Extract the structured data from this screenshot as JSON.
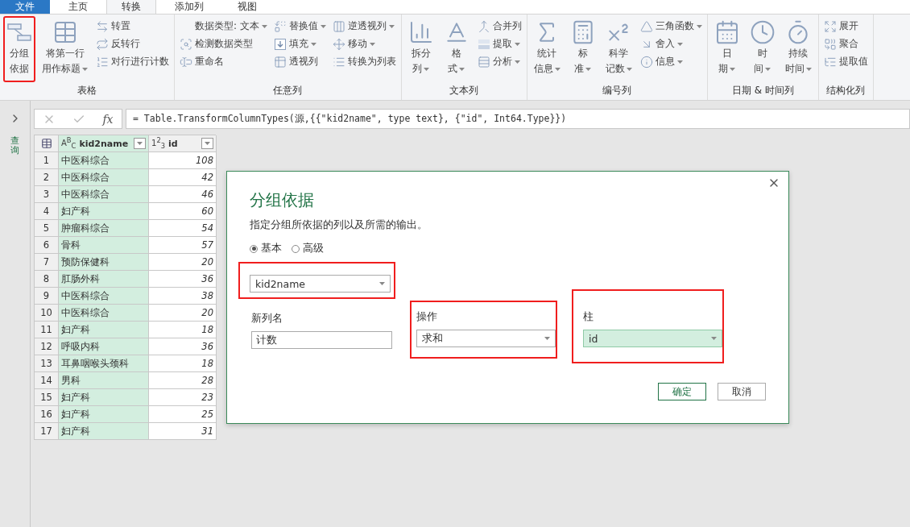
{
  "menu_tabs": [
    {
      "label": "文件",
      "kind": "file",
      "selected": false
    },
    {
      "label": "主页",
      "kind": "tab",
      "selected": false
    },
    {
      "label": "转换",
      "kind": "tab",
      "selected": true
    },
    {
      "label": "添加列",
      "kind": "tab",
      "selected": false
    },
    {
      "label": "视图",
      "kind": "tab",
      "selected": false
    }
  ],
  "ribbon": [
    {
      "label": "表格",
      "items": [
        {
          "kind": "large",
          "lines": [
            "分组",
            "依据"
          ],
          "dropdown": false,
          "highlighted": true
        },
        {
          "kind": "large",
          "lines": [
            "将第一行",
            "用作标题"
          ],
          "dropdown": true,
          "highlighted": false
        },
        {
          "kind": "small",
          "label": "转置",
          "dropdown": false
        },
        {
          "kind": "small",
          "label": "反转行",
          "dropdown": false
        },
        {
          "kind": "small",
          "label": "对行进行计数",
          "dropdown": false
        }
      ]
    },
    {
      "label": "任意列",
      "items": [
        {
          "kind": "small",
          "label": "数据类型: 文本",
          "dropdown": true
        },
        {
          "kind": "small",
          "label": "检测数据类型",
          "dropdown": false
        },
        {
          "kind": "small",
          "label": "重命名",
          "dropdown": false
        },
        {
          "kind": "small",
          "label": "替换值",
          "dropdown": true
        },
        {
          "kind": "small",
          "label": "填充",
          "dropdown": true
        },
        {
          "kind": "small",
          "label": "透视列",
          "dropdown": false
        },
        {
          "kind": "small",
          "label": "逆透视列",
          "dropdown": true
        },
        {
          "kind": "small",
          "label": "移动",
          "dropdown": true
        },
        {
          "kind": "small",
          "label": "转换为列表",
          "dropdown": false
        }
      ]
    },
    {
      "label": "文本列",
      "items": [
        {
          "kind": "large",
          "lines": [
            "拆分",
            "列"
          ],
          "dropdown": true,
          "highlighted": false
        },
        {
          "kind": "large",
          "lines": [
            "格",
            "式"
          ],
          "dropdown": true,
          "highlighted": false
        },
        {
          "kind": "small",
          "label": "合并列",
          "dropdown": false
        },
        {
          "kind": "small",
          "label": "提取",
          "dropdown": true
        },
        {
          "kind": "small",
          "label": "分析",
          "dropdown": true
        }
      ]
    },
    {
      "label": "编号列",
      "items": [
        {
          "kind": "large",
          "lines": [
            "统计",
            "信息"
          ],
          "dropdown": true,
          "highlighted": false
        },
        {
          "kind": "large",
          "lines": [
            "标",
            "准"
          ],
          "dropdown": true,
          "highlighted": false
        },
        {
          "kind": "large",
          "lines": [
            "科学",
            "记数"
          ],
          "dropdown": true,
          "highlighted": false
        },
        {
          "kind": "small",
          "label": "三角函数",
          "dropdown": true
        },
        {
          "kind": "small",
          "label": "舍入",
          "dropdown": true
        },
        {
          "kind": "small",
          "label": "信息",
          "dropdown": true
        }
      ]
    },
    {
      "label": "日期 & 时间列",
      "items": [
        {
          "kind": "large",
          "lines": [
            "日",
            "期"
          ],
          "dropdown": true,
          "highlighted": false
        },
        {
          "kind": "large",
          "lines": [
            "时",
            "间"
          ],
          "dropdown": true,
          "highlighted": false
        },
        {
          "kind": "large",
          "lines": [
            "持续",
            "时间"
          ],
          "dropdown": true,
          "highlighted": false
        }
      ]
    },
    {
      "label": "结构化列",
      "items": [
        {
          "kind": "small",
          "label": "展开",
          "dropdown": false
        },
        {
          "kind": "small",
          "label": "聚合",
          "dropdown": false
        },
        {
          "kind": "small",
          "label": "提取值",
          "dropdown": false
        }
      ]
    }
  ],
  "queries_pane": {
    "label": "查询",
    "expanded": false
  },
  "formula_bar": {
    "fx": "fx",
    "formula": "= Table.TransformColumnTypes(源,{{\"kid2name\", type text}, {\"id\", Int64.Type}})"
  },
  "table": {
    "columns": [
      {
        "name": "kid2name",
        "type": "A$^{B}$$_{C}$",
        "selected": true
      },
      {
        "name": "id",
        "type": "1$^{2}$$_{3}$",
        "selected": false
      }
    ],
    "rows": [
      {
        "number": "1",
        "cells": [
          "中医科综合",
          "108"
        ]
      },
      {
        "number": "2",
        "cells": [
          "中医科综合",
          "42"
        ]
      },
      {
        "number": "3",
        "cells": [
          "中医科综合",
          "46"
        ]
      },
      {
        "number": "4",
        "cells": [
          "妇产科",
          "60"
        ]
      },
      {
        "number": "5",
        "cells": [
          "肿瘤科综合",
          "54"
        ]
      },
      {
        "number": "6",
        "cells": [
          "骨科",
          "57"
        ]
      },
      {
        "number": "7",
        "cells": [
          "预防保健科",
          "20"
        ]
      },
      {
        "number": "8",
        "cells": [
          "肛肠外科",
          "36"
        ]
      },
      {
        "number": "9",
        "cells": [
          "中医科综合",
          "38"
        ]
      },
      {
        "number": "10",
        "cells": [
          "中医科综合",
          "20"
        ]
      },
      {
        "number": "11",
        "cells": [
          "妇产科",
          "18"
        ]
      },
      {
        "number": "12",
        "cells": [
          "呼吸内科",
          "36"
        ]
      },
      {
        "number": "13",
        "cells": [
          "耳鼻咽喉头颈科",
          "18"
        ]
      },
      {
        "number": "14",
        "cells": [
          "男科",
          "28"
        ]
      },
      {
        "number": "15",
        "cells": [
          "妇产科",
          "23"
        ]
      },
      {
        "number": "16",
        "cells": [
          "妇产科",
          "25"
        ]
      },
      {
        "number": "17",
        "cells": [
          "妇产科",
          "31"
        ]
      }
    ]
  },
  "dialog": {
    "title": "分组依据",
    "description": "指定分组所依据的列以及所需的输出。",
    "modes": [
      {
        "label": "基本",
        "selected": true
      },
      {
        "label": "高级",
        "selected": false
      }
    ],
    "group_by": {
      "value": "kid2name",
      "highlighted": true
    },
    "fields": [
      {
        "kind": "text",
        "label": "新列名",
        "value": "计数",
        "highlighted": false
      },
      {
        "kind": "select",
        "label": "操作",
        "value": "求和",
        "highlighted": true
      },
      {
        "kind": "select",
        "label": "柱",
        "value": "id",
        "highlighted": true,
        "focused": true
      }
    ],
    "buttons": [
      {
        "label": "确定",
        "primary": true
      },
      {
        "label": "取消",
        "primary": false
      }
    ]
  }
}
